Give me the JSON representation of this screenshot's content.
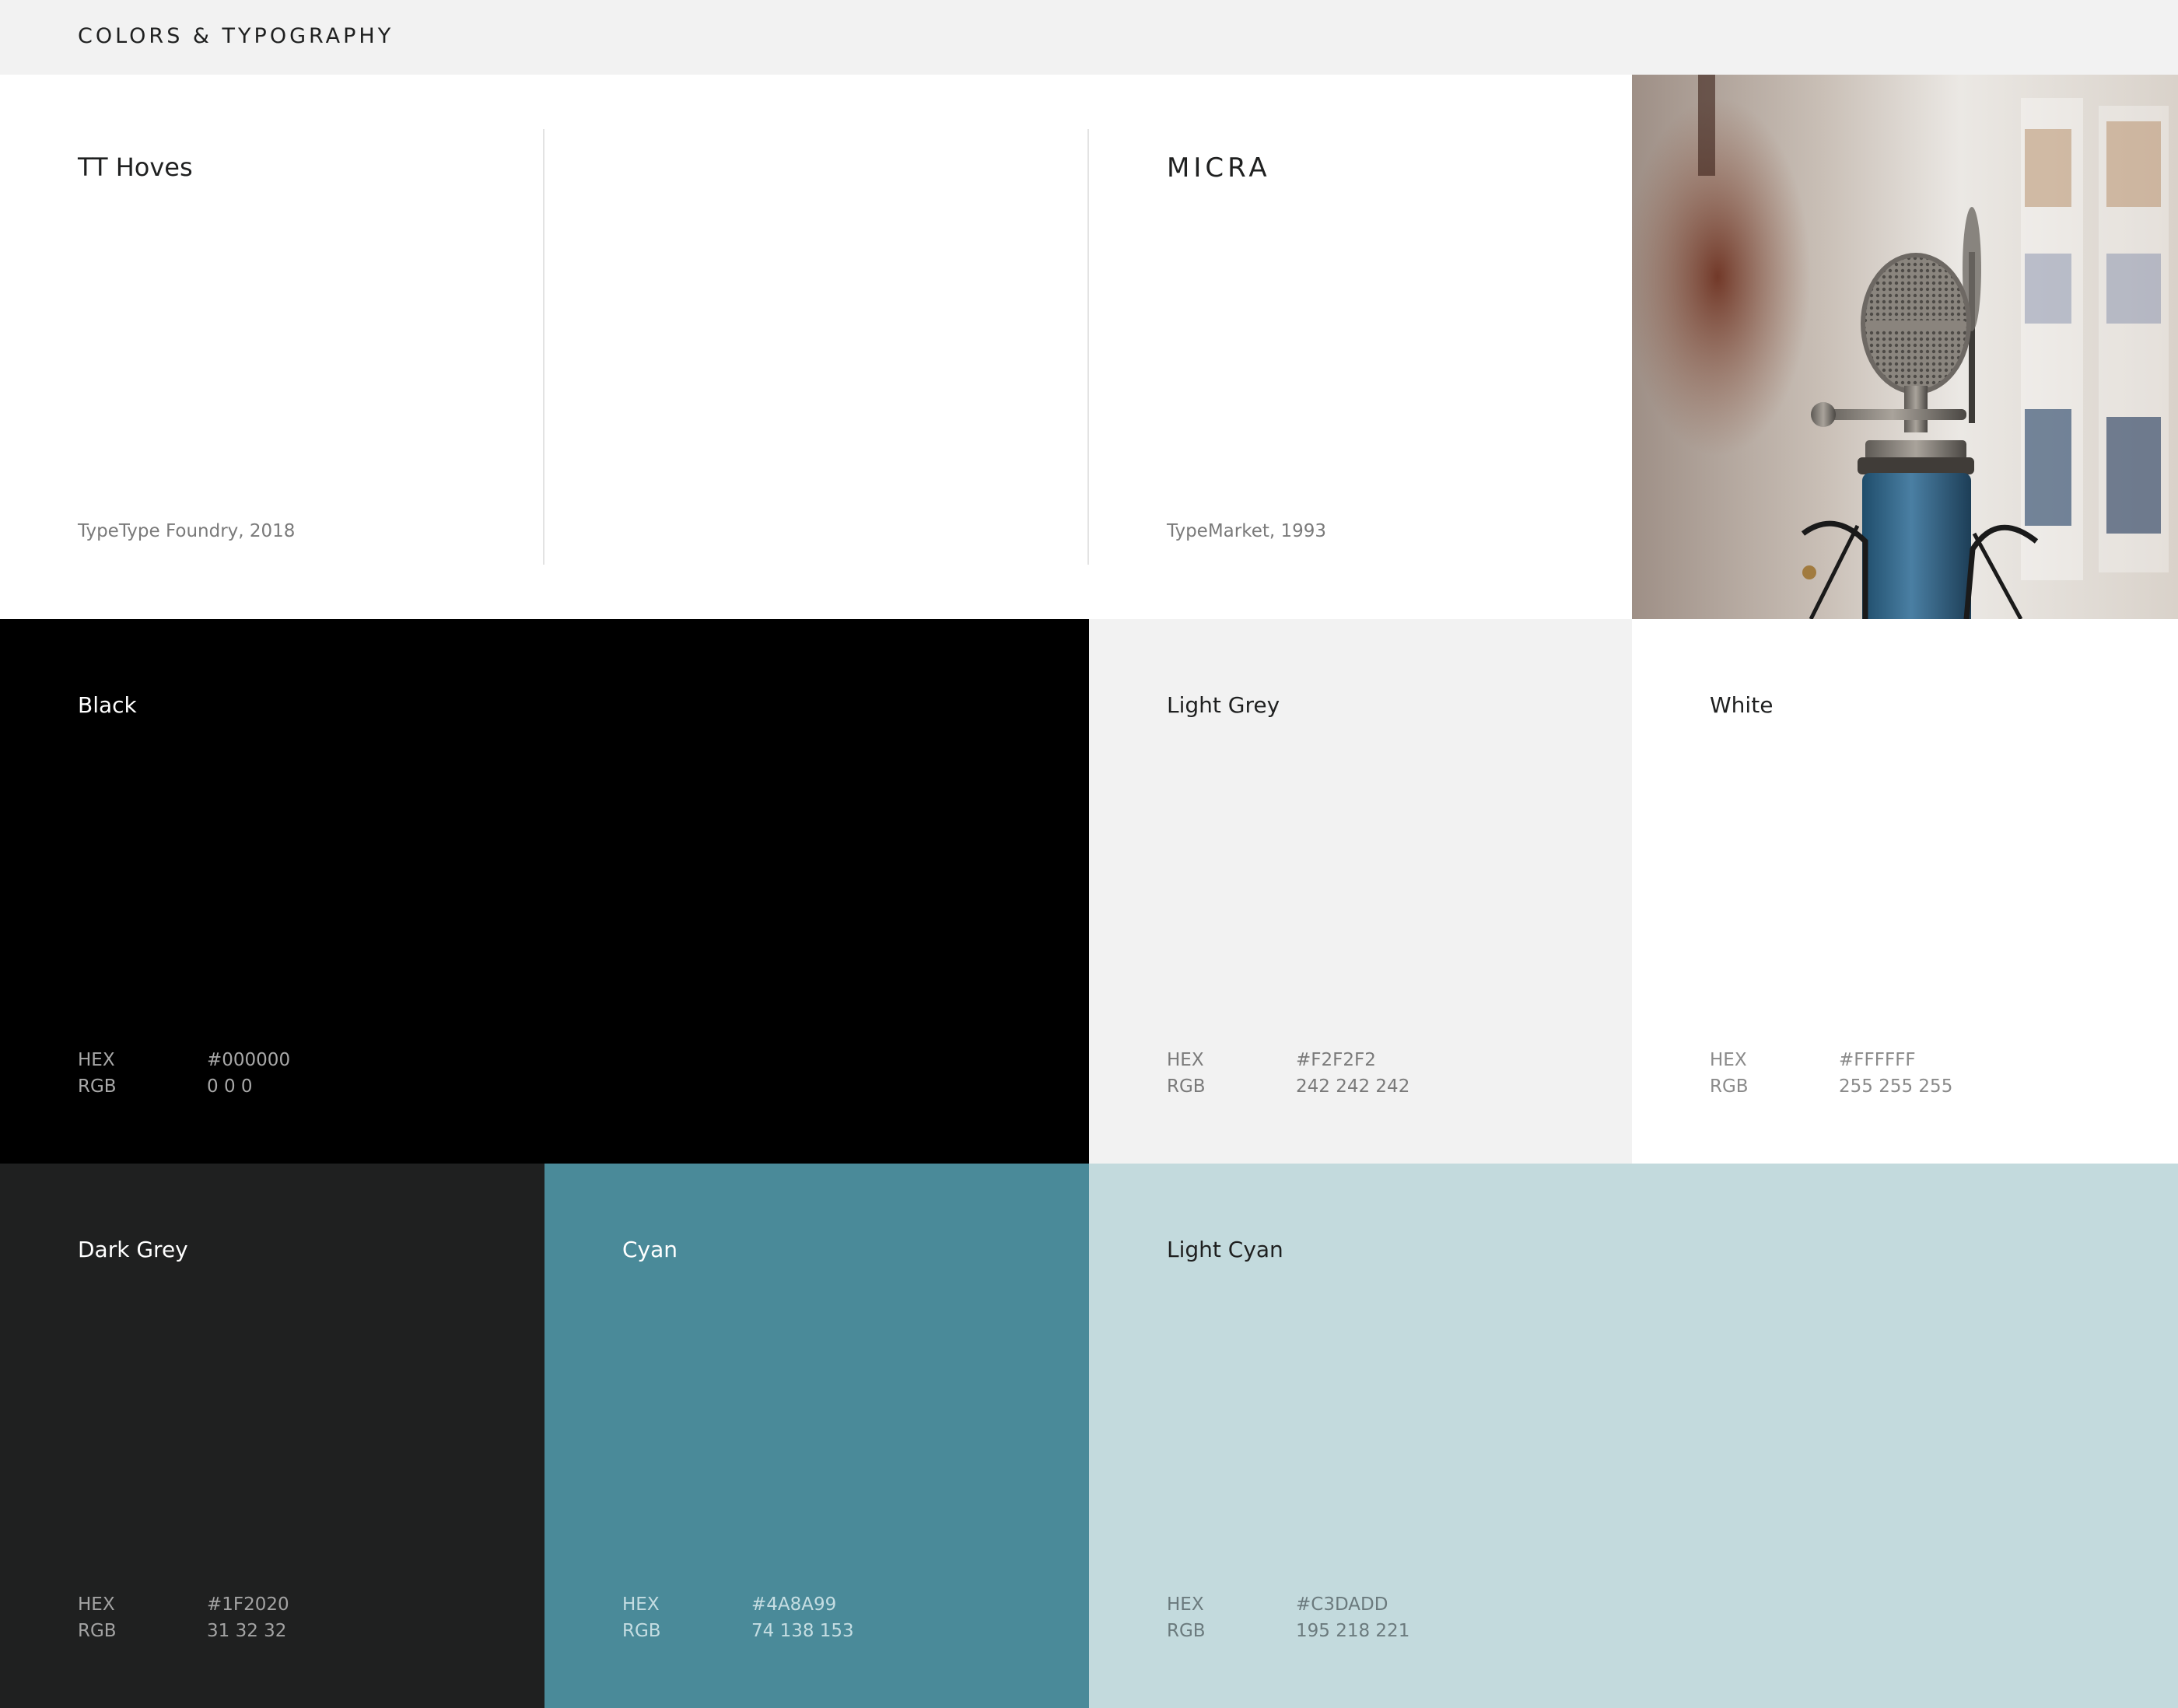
{
  "header": {
    "title": "COLORS & TYPOGRAPHY"
  },
  "typography": [
    {
      "name": "TT Hoves",
      "credit": "TypeType Foundry, 2018"
    },
    {
      "name": "MICRA",
      "credit": "TypeMarket, 1993"
    }
  ],
  "photo": {
    "subject": "microphone-photo"
  },
  "swatches": {
    "black": {
      "name": "Black",
      "hex_label": "HEX",
      "hex": "#000000",
      "rgb_label": "RGB",
      "rgb": "0 0 0"
    },
    "light_grey": {
      "name": "Light Grey",
      "hex_label": "HEX",
      "hex": "#F2F2F2",
      "rgb_label": "RGB",
      "rgb": "242 242 242"
    },
    "white": {
      "name": "White",
      "hex_label": "HEX",
      "hex": "#FFFFFF",
      "rgb_label": "RGB",
      "rgb": "255 255 255"
    },
    "dark_grey": {
      "name": "Dark Grey",
      "hex_label": "HEX",
      "hex": "#1F2020",
      "rgb_label": "RGB",
      "rgb": "31 32 32"
    },
    "cyan": {
      "name": "Cyan",
      "hex_label": "HEX",
      "hex": "#4A8A99",
      "rgb_label": "RGB",
      "rgb": "74 138 153"
    },
    "light_cyan": {
      "name": "Light Cyan",
      "hex_label": "HEX",
      "hex": "#C3DADD",
      "rgb_label": "RGB",
      "rgb": "195 218 221"
    }
  }
}
